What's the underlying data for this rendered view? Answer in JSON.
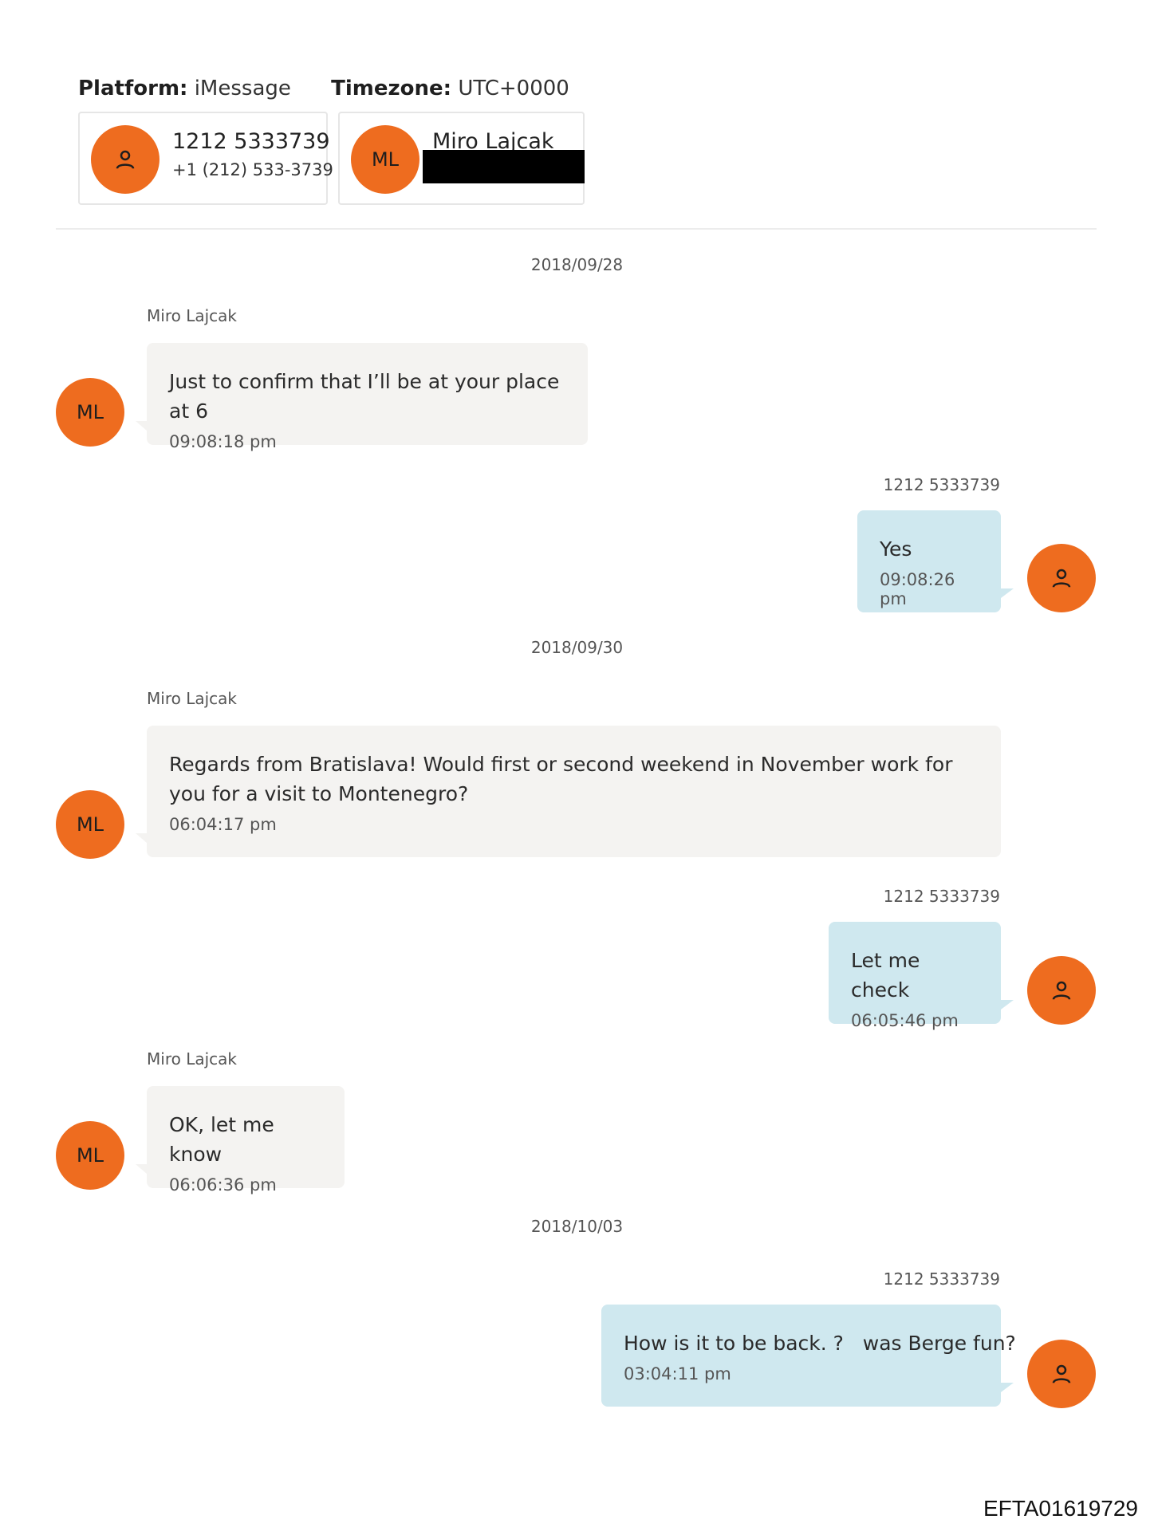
{
  "header": {
    "platform_label": "Platform:",
    "platform_value": "iMessage",
    "timezone_label": "Timezone:",
    "timezone_value": "UTC+0000"
  },
  "participants": [
    {
      "name": "1212 5333739",
      "sub": "+1 (212) 533-3739",
      "avatar_icon": "person-icon"
    },
    {
      "name": "Miro Lajcak",
      "initials": "ML",
      "sub_redacted": true
    }
  ],
  "colors": {
    "avatar": "#ee6c1f",
    "incoming_bubble": "#f4f3f1",
    "outgoing_bubble": "#cfe8ef"
  },
  "dates": [
    "2018/09/28",
    "2018/09/30",
    "2018/10/03"
  ],
  "messages": [
    {
      "sender": "Miro Lajcak",
      "initials": "ML",
      "text": "Just to confirm that I’ll be at your place at 6",
      "time": "09:08:18 pm"
    },
    {
      "sender": "1212 5333739",
      "text": "Yes",
      "time": "09:08:26 pm"
    },
    {
      "sender": "Miro Lajcak",
      "initials": "ML",
      "text": "Regards from Bratislava! Would first or second weekend in November work for you for a visit to Montenegro?",
      "time": "06:04:17 pm"
    },
    {
      "sender": "1212 5333739",
      "text": "Let me check",
      "time": "06:05:46 pm"
    },
    {
      "sender": "Miro Lajcak",
      "initials": "ML",
      "text": "OK, let me know",
      "time": "06:06:36 pm"
    },
    {
      "sender": "1212 5333739",
      "text": "How is it to be back. ?   was Berge fun?",
      "time": "03:04:11 pm"
    }
  ],
  "bates_number": "EFTA01619729"
}
